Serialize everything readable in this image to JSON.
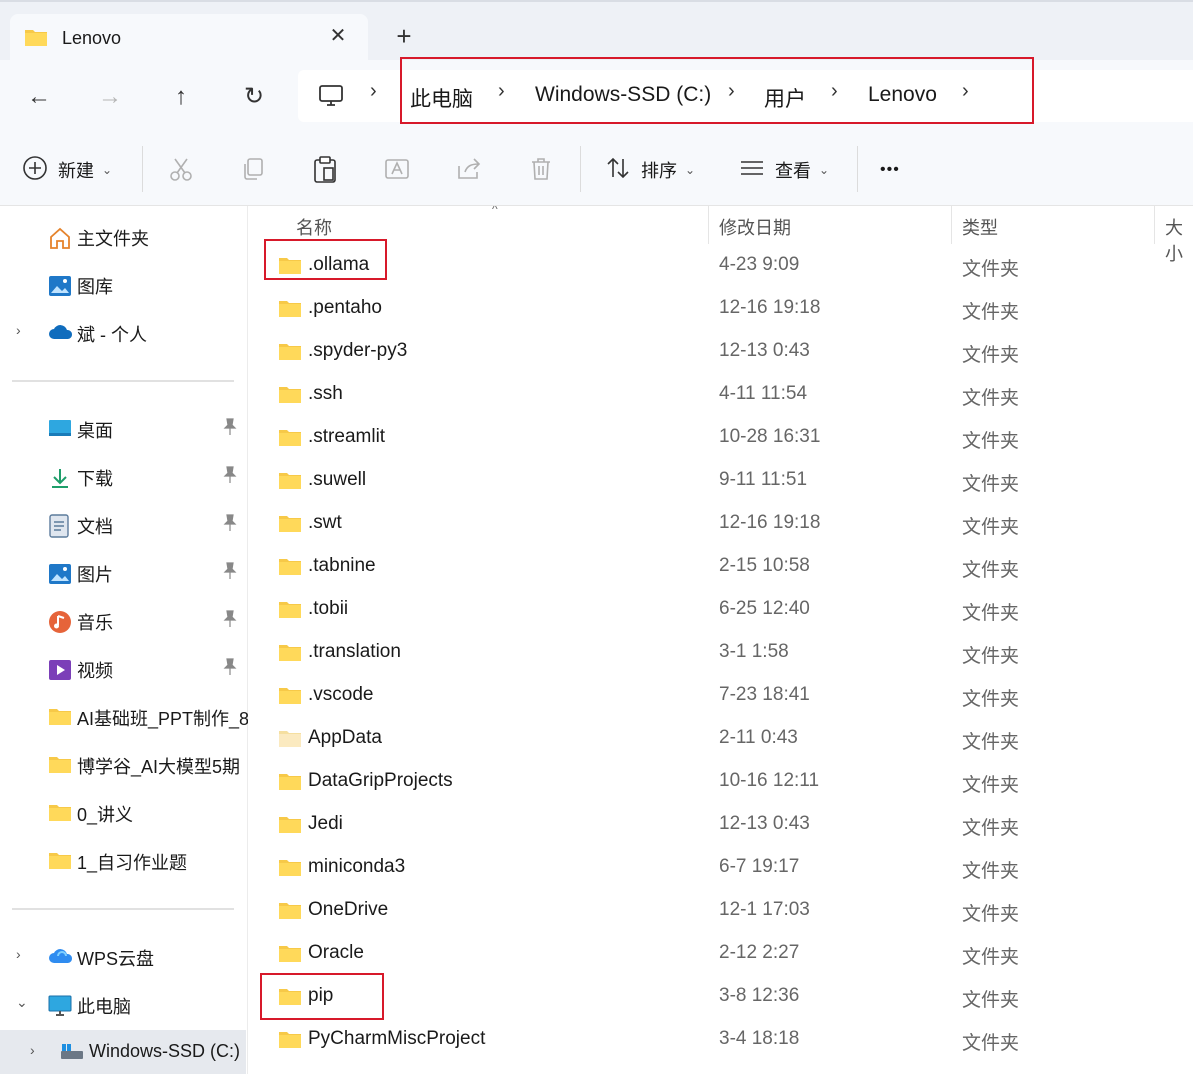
{
  "window": {
    "tab_title": "Lenovo",
    "close_glyph": "✕",
    "new_tab_glyph": "+"
  },
  "nav": {
    "back_glyph": "←",
    "forward_glyph": "→",
    "up_glyph": "↑",
    "refresh_glyph": "↻"
  },
  "address": {
    "separator": "›",
    "crumbs": [
      "此电脑",
      "Windows-SSD (C:)",
      "用户",
      "Lenovo"
    ]
  },
  "toolbar": {
    "new_label": "新建",
    "sort_label": "排序",
    "view_label": "查看",
    "more_glyph": "•••",
    "chevron_glyph": "⌄"
  },
  "sidebar": {
    "top_items": [
      {
        "label": "主文件夹",
        "icon": "home-icon"
      },
      {
        "label": "图库",
        "icon": "gallery-icon"
      },
      {
        "label": "斌 - 个人",
        "icon": "onedrive-icon"
      }
    ],
    "quick_access": [
      {
        "label": "桌面",
        "icon": "desktop-icon"
      },
      {
        "label": "下载",
        "icon": "download-icon"
      },
      {
        "label": "文档",
        "icon": "documents-icon"
      },
      {
        "label": "图片",
        "icon": "pictures-icon"
      },
      {
        "label": "音乐",
        "icon": "music-icon"
      },
      {
        "label": "视频",
        "icon": "videos-icon"
      },
      {
        "label": "AI基础班_PPT制作_8",
        "icon": "folder-icon"
      },
      {
        "label": "博学谷_AI大模型5期",
        "icon": "folder-icon"
      },
      {
        "label": "0_讲义",
        "icon": "folder-icon"
      },
      {
        "label": "1_自习作业题",
        "icon": "folder-icon"
      }
    ],
    "bottom_items": [
      {
        "label": "WPS云盘",
        "icon": "wps-cloud-icon"
      },
      {
        "label": "此电脑",
        "icon": "this-pc-icon"
      },
      {
        "label": "Windows-SSD (C:)",
        "icon": "drive-icon"
      }
    ],
    "chevron_right": "›",
    "chevron_down": "⌄"
  },
  "list": {
    "columns": {
      "name": "名称",
      "modified": "修改日期",
      "type": "类型",
      "size": "大小"
    },
    "sort_glyph": "^",
    "rows": [
      {
        "name": ".ollama",
        "date": "4-23 9:09",
        "type": "文件夹"
      },
      {
        "name": ".pentaho",
        "date": "12-16 19:18",
        "type": "文件夹"
      },
      {
        "name": ".spyder-py3",
        "date": "12-13 0:43",
        "type": "文件夹"
      },
      {
        "name": ".ssh",
        "date": "4-11 11:54",
        "type": "文件夹"
      },
      {
        "name": ".streamlit",
        "date": "10-28 16:31",
        "type": "文件夹"
      },
      {
        "name": ".suwell",
        "date": "9-11 11:51",
        "type": "文件夹"
      },
      {
        "name": ".swt",
        "date": "12-16 19:18",
        "type": "文件夹"
      },
      {
        "name": ".tabnine",
        "date": "2-15 10:58",
        "type": "文件夹"
      },
      {
        "name": ".tobii",
        "date": "6-25 12:40",
        "type": "文件夹"
      },
      {
        "name": ".translation",
        "date": "3-1 1:58",
        "type": "文件夹"
      },
      {
        "name": ".vscode",
        "date": "7-23 18:41",
        "type": "文件夹"
      },
      {
        "name": "AppData",
        "date": "2-11 0:43",
        "type": "文件夹"
      },
      {
        "name": "DataGripProjects",
        "date": "10-16 12:11",
        "type": "文件夹"
      },
      {
        "name": "Jedi",
        "date": "12-13 0:43",
        "type": "文件夹"
      },
      {
        "name": "miniconda3",
        "date": "6-7 19:17",
        "type": "文件夹"
      },
      {
        "name": "OneDrive",
        "date": "12-1 17:03",
        "type": "文件夹"
      },
      {
        "name": "Oracle",
        "date": "2-12 2:27",
        "type": "文件夹"
      },
      {
        "name": "pip",
        "date": "3-8 12:36",
        "type": "文件夹"
      },
      {
        "name": "PyCharmMiscProject",
        "date": "3-4 18:18",
        "type": "文件夹"
      }
    ]
  },
  "colors": {
    "highlight": "#d7192a",
    "folder": "#f7c948",
    "accent": "#0067c0"
  }
}
